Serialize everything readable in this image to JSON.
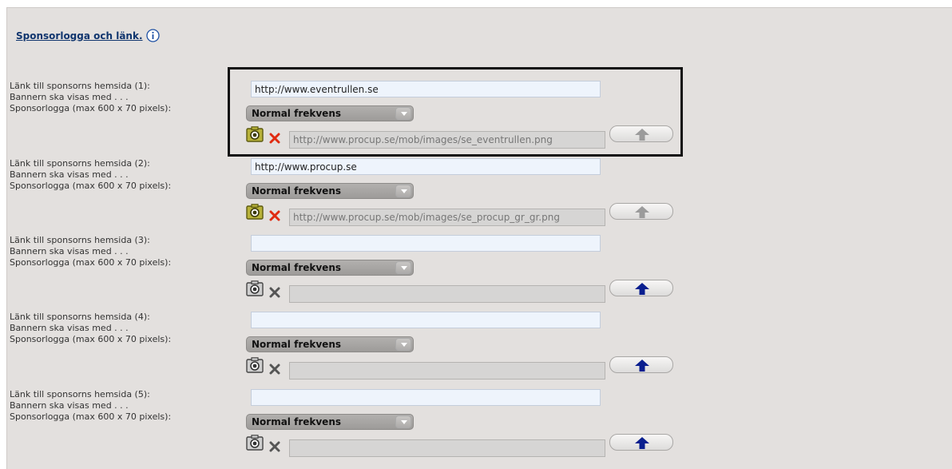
{
  "header": {
    "title": "Sponsorlogga och länk.",
    "info_icon": "info-circle-icon"
  },
  "sponsors": [
    {
      "link_label": "Länk till sponsorns hemsida (1):",
      "frequency_label": "Bannern ska visas med . . .",
      "logo_label": "Sponsorlogga (max 600 x 70 pixels):",
      "url": "http://www.eventrullen.se",
      "frequency": "Normal frekvens",
      "logo_path": "http://www.procup.se/mob/images/se_eventrullen.png",
      "has_logo": true
    },
    {
      "link_label": "Länk till sponsorns hemsida (2):",
      "frequency_label": "Bannern ska visas med . . .",
      "logo_label": "Sponsorlogga (max 600 x 70 pixels):",
      "url": "http://www.procup.se",
      "frequency": "Normal frekvens",
      "logo_path": "http://www.procup.se/mob/images/se_procup_gr_gr.png",
      "has_logo": true
    },
    {
      "link_label": "Länk till sponsorns hemsida (3):",
      "frequency_label": "Bannern ska visas med . . .",
      "logo_label": "Sponsorlogga (max 600 x 70 pixels):",
      "url": "",
      "frequency": "Normal frekvens",
      "logo_path": "",
      "has_logo": false
    },
    {
      "link_label": "Länk till sponsorns hemsida (4):",
      "frequency_label": "Bannern ska visas med . . .",
      "logo_label": "Sponsorlogga (max 600 x 70 pixels):",
      "url": "",
      "frequency": "Normal frekvens",
      "logo_path": "",
      "has_logo": false
    },
    {
      "link_label": "Länk till sponsorns hemsida (5):",
      "frequency_label": "Bannern ska visas med . . .",
      "logo_label": "Sponsorlogga (max 600 x 70 pixels):",
      "url": "",
      "frequency": "Normal frekvens",
      "logo_path": "",
      "has_logo": false
    }
  ],
  "colors": {
    "active_upload_arrow": "#0a1f8f",
    "disabled_upload_arrow": "#9b9b9b",
    "delete_active": "#e02a10",
    "delete_inactive": "#555555"
  },
  "icons": {
    "camera": "camera-icon",
    "delete": "delete-x-icon",
    "upload": "upload-arrow-icon",
    "dropdown": "chevron-down-icon"
  }
}
